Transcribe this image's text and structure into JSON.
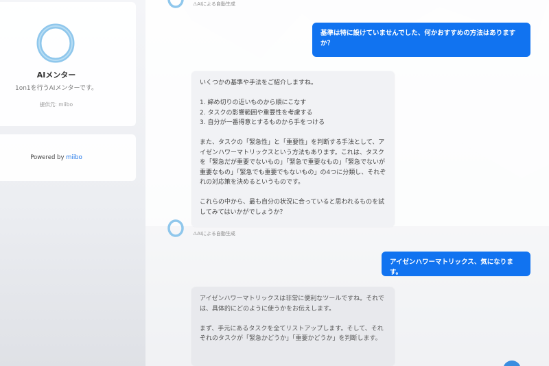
{
  "sidebar": {
    "bot_name": "AIメンター",
    "bot_description": "1on1を行うAIメンターです。",
    "provider": "提供元: miibo",
    "powered_prefix": "Powered by ",
    "powered_link": "miibo"
  },
  "chat": {
    "ai_label_top": "⚠AIによる自動生成",
    "messages": [
      {
        "role": "user",
        "text": "基準は特に設けていませんでした、何かおすすめの方法はありますか？"
      },
      {
        "role": "ai",
        "text": "いくつかの基準や手法をご紹介しますね。\n\n1. 締め切りの近いものから順にこなす\n2. タスクの影響範囲や重要性を考慮する\n3. 自分が一番得意とするものから手をつける\n\nまた、タスクの「緊急性」と「重要性」を判断する手法として、アイゼンハワーマトリックスという方法もあります。これは、タスクを「緊急だが重要でないもの」「緊急で重要なもの」「緊急でないが重要なもの」「緊急でも重要でもないもの」の4つに分類し、それぞれの対応策を決めるというものです。\n\nこれらの中から、最も自分の状況に合っていると思われるものを試してみてはいかがでしょうか？",
        "label": "⚠AIによる自動生成"
      },
      {
        "role": "user",
        "text": "アイゼンハワーマトリックス、気になります。"
      },
      {
        "role": "ai",
        "text": "アイゼンハワーマトリックスは非常に便利なツールですね。それでは、具体的にどのように使うかをお伝えします。\n\nまず、手元にあるタスクを全てリストアップします。そして、それぞれのタスクが「緊急かどうか」「重要かどうか」を判断します。"
      }
    ]
  },
  "colors": {
    "accent": "#1173f0",
    "avatar_ring": "#8fc7ec",
    "link": "#1a73e8"
  },
  "icons": {
    "avatar": "ring-logo-icon",
    "warning": "warning-icon"
  }
}
